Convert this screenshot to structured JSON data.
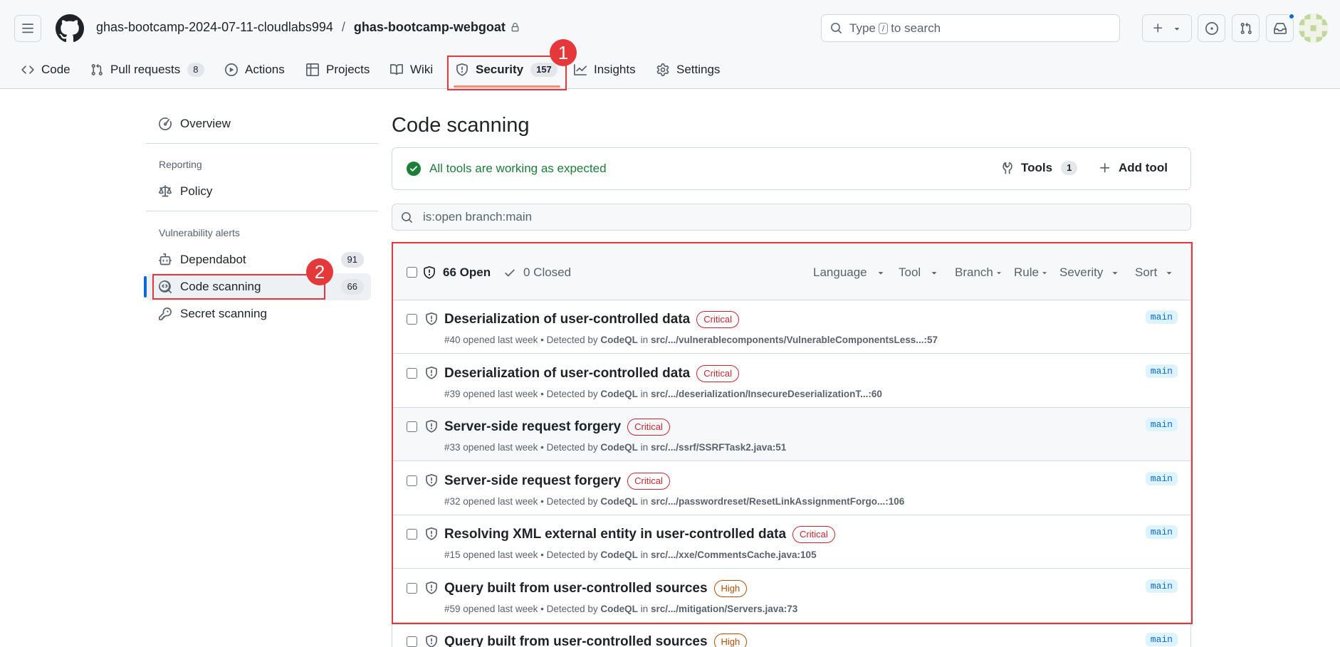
{
  "header": {
    "owner": "ghas-bootcamp-2024-07-11-cloudlabs994",
    "separator": "/",
    "repo": "ghas-bootcamp-webgoat",
    "search_prefix": "Type",
    "search_key": "/",
    "search_suffix": "to search"
  },
  "repo_nav": {
    "tabs": [
      {
        "label": "Code",
        "icon": "code-icon"
      },
      {
        "label": "Pull requests",
        "count": "8",
        "icon": "git-pull-request-icon"
      },
      {
        "label": "Actions",
        "icon": "play-icon"
      },
      {
        "label": "Projects",
        "icon": "table-icon"
      },
      {
        "label": "Wiki",
        "icon": "book-icon"
      },
      {
        "label": "Security",
        "count": "157",
        "icon": "shield-icon",
        "selected": true
      },
      {
        "label": "Insights",
        "icon": "graph-icon"
      },
      {
        "label": "Settings",
        "icon": "gear-icon"
      }
    ]
  },
  "annotations": {
    "marker1": "1",
    "marker2": "2",
    "color": "#e5383b"
  },
  "sidebar": {
    "overview": "Overview",
    "reporting_heading": "Reporting",
    "policy": "Policy",
    "vuln_heading": "Vulnerability alerts",
    "dependabot": {
      "label": "Dependabot",
      "count": "91"
    },
    "code_scanning": {
      "label": "Code scanning",
      "count": "66"
    },
    "secret_scanning": "Secret scanning"
  },
  "main": {
    "title": "Code scanning",
    "status": "All tools are working as expected",
    "tools_label": "Tools",
    "tools_count": "1",
    "add_tool": "Add tool",
    "filter_value": "is:open branch:main"
  },
  "alerts": {
    "open_label": "66 Open",
    "closed_label": "0 Closed",
    "filters": [
      "Language",
      "Tool",
      "Branch",
      "Rule",
      "Severity",
      "Sort"
    ],
    "meta_opened": "opened last week • Detected by",
    "meta_tool": "CodeQL",
    "meta_in": "in",
    "rows": [
      {
        "title": "Deserialization of user-controlled data",
        "severity": "Critical",
        "number": "#40",
        "path": "src/.../vulnerablecomponents/VulnerableComponentsLess...:57",
        "branch": "main"
      },
      {
        "title": "Deserialization of user-controlled data",
        "severity": "Critical",
        "number": "#39",
        "path": "src/.../deserialization/InsecureDeserializationT...:60",
        "branch": "main"
      },
      {
        "title": "Server-side request forgery",
        "severity": "Critical",
        "number": "#33",
        "path": "src/.../ssrf/SSRFTask2.java:51",
        "branch": "main"
      },
      {
        "title": "Server-side request forgery",
        "severity": "Critical",
        "number": "#32",
        "path": "src/.../passwordreset/ResetLinkAssignmentForgo...:106",
        "branch": "main"
      },
      {
        "title": "Resolving XML external entity in user-controlled data",
        "severity": "Critical",
        "number": "#15",
        "path": "src/.../xxe/CommentsCache.java:105",
        "branch": "main"
      },
      {
        "title": "Query built from user-controlled sources",
        "severity": "High",
        "number": "#59",
        "path": "src/.../mitigation/Servers.java:73",
        "branch": "main"
      },
      {
        "title": "Query built from user-controlled sources",
        "severity": "High",
        "number": "",
        "path": "",
        "branch": "main"
      }
    ]
  }
}
